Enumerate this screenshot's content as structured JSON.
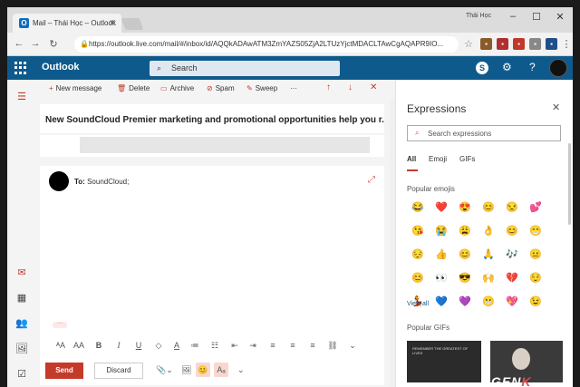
{
  "browser": {
    "tab_title": "Mail – Thái Học – Outlook",
    "tab_icon_letter": "O",
    "profile_name": "Thái Học",
    "url": "https://outlook.live.com/mail/#/inbox/id/AQQkADAwATM3ZmYAZS05ZjA2LTUzYjctMDACLTAwCgAQAPR9IO..."
  },
  "outlook": {
    "app_name": "Outlook",
    "search_placeholder": "Search"
  },
  "commands": {
    "new_message": "New message",
    "delete": "Delete",
    "archive": "Archive",
    "spam": "Spam",
    "sweep": "Sweep",
    "more": "···"
  },
  "message": {
    "subject": "New SoundCloud Premier marketing and promotional opportunities help you r..."
  },
  "compose": {
    "to_label": "To:",
    "to_value": "SoundCloud;",
    "more_dots": "···",
    "send_label": "Send",
    "discard_label": "Discard"
  },
  "expressions": {
    "title": "Expressions",
    "search_placeholder": "Search expressions",
    "tabs": [
      "All",
      "Emoji",
      "GIFs"
    ],
    "active_tab": "All",
    "popular_emojis_label": "Popular emojis",
    "view_all_label": "View all",
    "popular_gifs_label": "Popular GIFs",
    "gif_caption": "REMEMBER THE GREATEST OF LIVES"
  },
  "emojis": [
    "😂",
    "❤️",
    "😍",
    "😊",
    "😒",
    "💕",
    "😘",
    "😭",
    "😩",
    "👌",
    "😊",
    "😁",
    "😔",
    "👍",
    "😊",
    "🙏",
    "🎶",
    "😐",
    "😊",
    "👀",
    "😎",
    "🙌",
    "💔",
    "😌",
    "💃",
    "💙",
    "💜",
    "😬",
    "💖",
    "😉"
  ],
  "watermark": "GENK"
}
